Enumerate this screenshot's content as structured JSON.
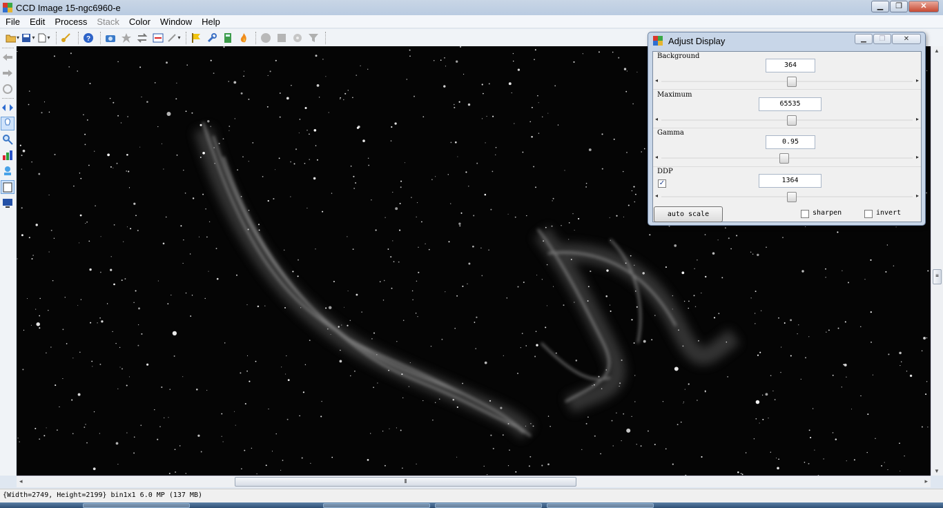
{
  "window": {
    "title": "CCD Image 15-ngc6960-e",
    "controls": {
      "minimize": "▁",
      "restore": "❐",
      "close": "✕"
    }
  },
  "menu": [
    "File",
    "Edit",
    "Process",
    "Stack",
    "Color",
    "Window",
    "Help"
  ],
  "menu_disabled": [
    "Stack"
  ],
  "toolbar_icons": [
    "open-folder-icon",
    "save-disk-icon",
    "new-document-icon",
    "key-icon",
    "help-icon",
    "camera-icon",
    "star-icon",
    "swap-icon",
    "line-profile-icon",
    "wand-icon",
    "flag-icon",
    "wrench-icon",
    "calculator-icon",
    "flame-icon",
    "disk-gray-icon",
    "stop-gray-icon",
    "gear-gray-icon",
    "filter-funnel-icon"
  ],
  "side_toolbar_icons": [
    "back-arrow-icon",
    "forward-arrow-icon",
    "rotate-icon",
    "resize-arrows-icon",
    "pointer-icon",
    "zoom-icon",
    "histogram-icon",
    "stamp-icon",
    "clipboard-icon",
    "display-icon"
  ],
  "adjust_display": {
    "title": "Adjust Display",
    "background": {
      "label": "Background",
      "value": "364",
      "slider_fraction": 0.5
    },
    "maximum": {
      "label": "Maximum",
      "value": "65535",
      "slider_fraction": 0.5
    },
    "gamma": {
      "label": "Gamma",
      "value": "0.95",
      "slider_fraction": 0.47
    },
    "ddp": {
      "label": "DDP",
      "value": "1364",
      "checked": true,
      "slider_fraction": 0.5
    },
    "auto_scale_label": "auto scale",
    "sharpen_label": "sharpen",
    "sharpen_checked": false,
    "invert_label": "invert",
    "invert_checked": false
  },
  "status": "{Width=2749, Height=2199} bin1x1  6.0 MP (137 MB)",
  "colors": {
    "titlebar": "#c9d6e6",
    "canvas": "#050505",
    "taskbar": "#2f4f74"
  }
}
